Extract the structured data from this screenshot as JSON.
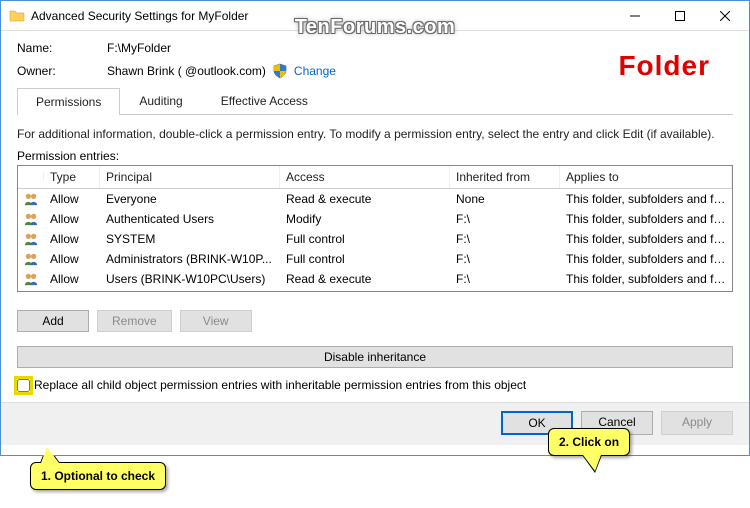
{
  "titlebar": {
    "title": "Advanced Security Settings for MyFolder"
  },
  "watermark": "TenForums.com",
  "folderlabel": "Folder",
  "name": {
    "label": "Name:",
    "value": "F:\\MyFolder"
  },
  "owner": {
    "label": "Owner:",
    "value": "Shawn Brink (            @outlook.com)",
    "change": "Change"
  },
  "tabs": {
    "permissions": "Permissions",
    "auditing": "Auditing",
    "effective": "Effective Access"
  },
  "info": "For additional information, double-click a permission entry. To modify a permission entry, select the entry and click Edit (if available).",
  "entries_label": "Permission entries:",
  "headers": {
    "type": "Type",
    "principal": "Principal",
    "access": "Access",
    "inherited": "Inherited from",
    "applies": "Applies to"
  },
  "rows": [
    {
      "type": "Allow",
      "principal": "Everyone",
      "access": "Read & execute",
      "inherited": "None",
      "applies": "This folder, subfolders and files"
    },
    {
      "type": "Allow",
      "principal": "Authenticated Users",
      "access": "Modify",
      "inherited": "F:\\",
      "applies": "This folder, subfolders and files"
    },
    {
      "type": "Allow",
      "principal": "SYSTEM",
      "access": "Full control",
      "inherited": "F:\\",
      "applies": "This folder, subfolders and files"
    },
    {
      "type": "Allow",
      "principal": "Administrators (BRINK-W10P...",
      "access": "Full control",
      "inherited": "F:\\",
      "applies": "This folder, subfolders and files"
    },
    {
      "type": "Allow",
      "principal": "Users (BRINK-W10PC\\Users)",
      "access": "Read & execute",
      "inherited": "F:\\",
      "applies": "This folder, subfolders and files"
    }
  ],
  "buttons": {
    "add": "Add",
    "remove": "Remove",
    "view": "View",
    "disable": "Disable inheritance",
    "replace": "Replace all child object permission entries with inheritable permission entries from this object",
    "ok": "OK",
    "cancel": "Cancel",
    "apply": "Apply"
  },
  "callouts": {
    "c1": "1. Optional to check",
    "c2": "2. Click on"
  }
}
